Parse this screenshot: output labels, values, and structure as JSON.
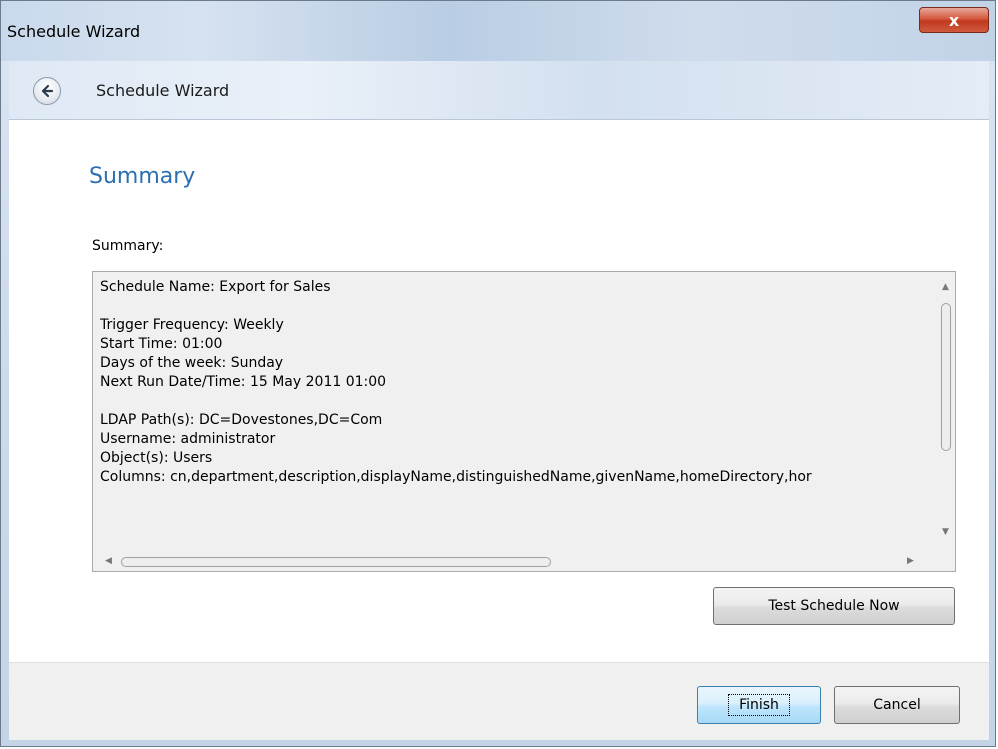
{
  "window": {
    "title": "Schedule Wizard",
    "close_glyph": "x"
  },
  "nav": {
    "back_icon": "back-arrow-icon",
    "title": "Schedule Wizard"
  },
  "page": {
    "heading": "Summary",
    "summary_label": "Summary:",
    "summary_text": "Schedule Name: Export for Sales\n\nTrigger Frequency: Weekly\nStart Time: 01:00\nDays of the week: Sunday\nNext Run Date/Time: 15 May 2011 01:00\n\nLDAP Path(s): DC=Dovestones,DC=Com\nUsername: administrator\nObject(s): Users\nColumns: cn,department,description,displayName,distinguishedName,givenName,homeDirectory,hor",
    "test_button": "Test Schedule Now"
  },
  "footer": {
    "finish_button": "Finish",
    "cancel_button": "Cancel"
  },
  "colors": {
    "heading": "#2a6fb1",
    "close_button": "#c8432a",
    "finish_border": "#3c7fb1"
  }
}
